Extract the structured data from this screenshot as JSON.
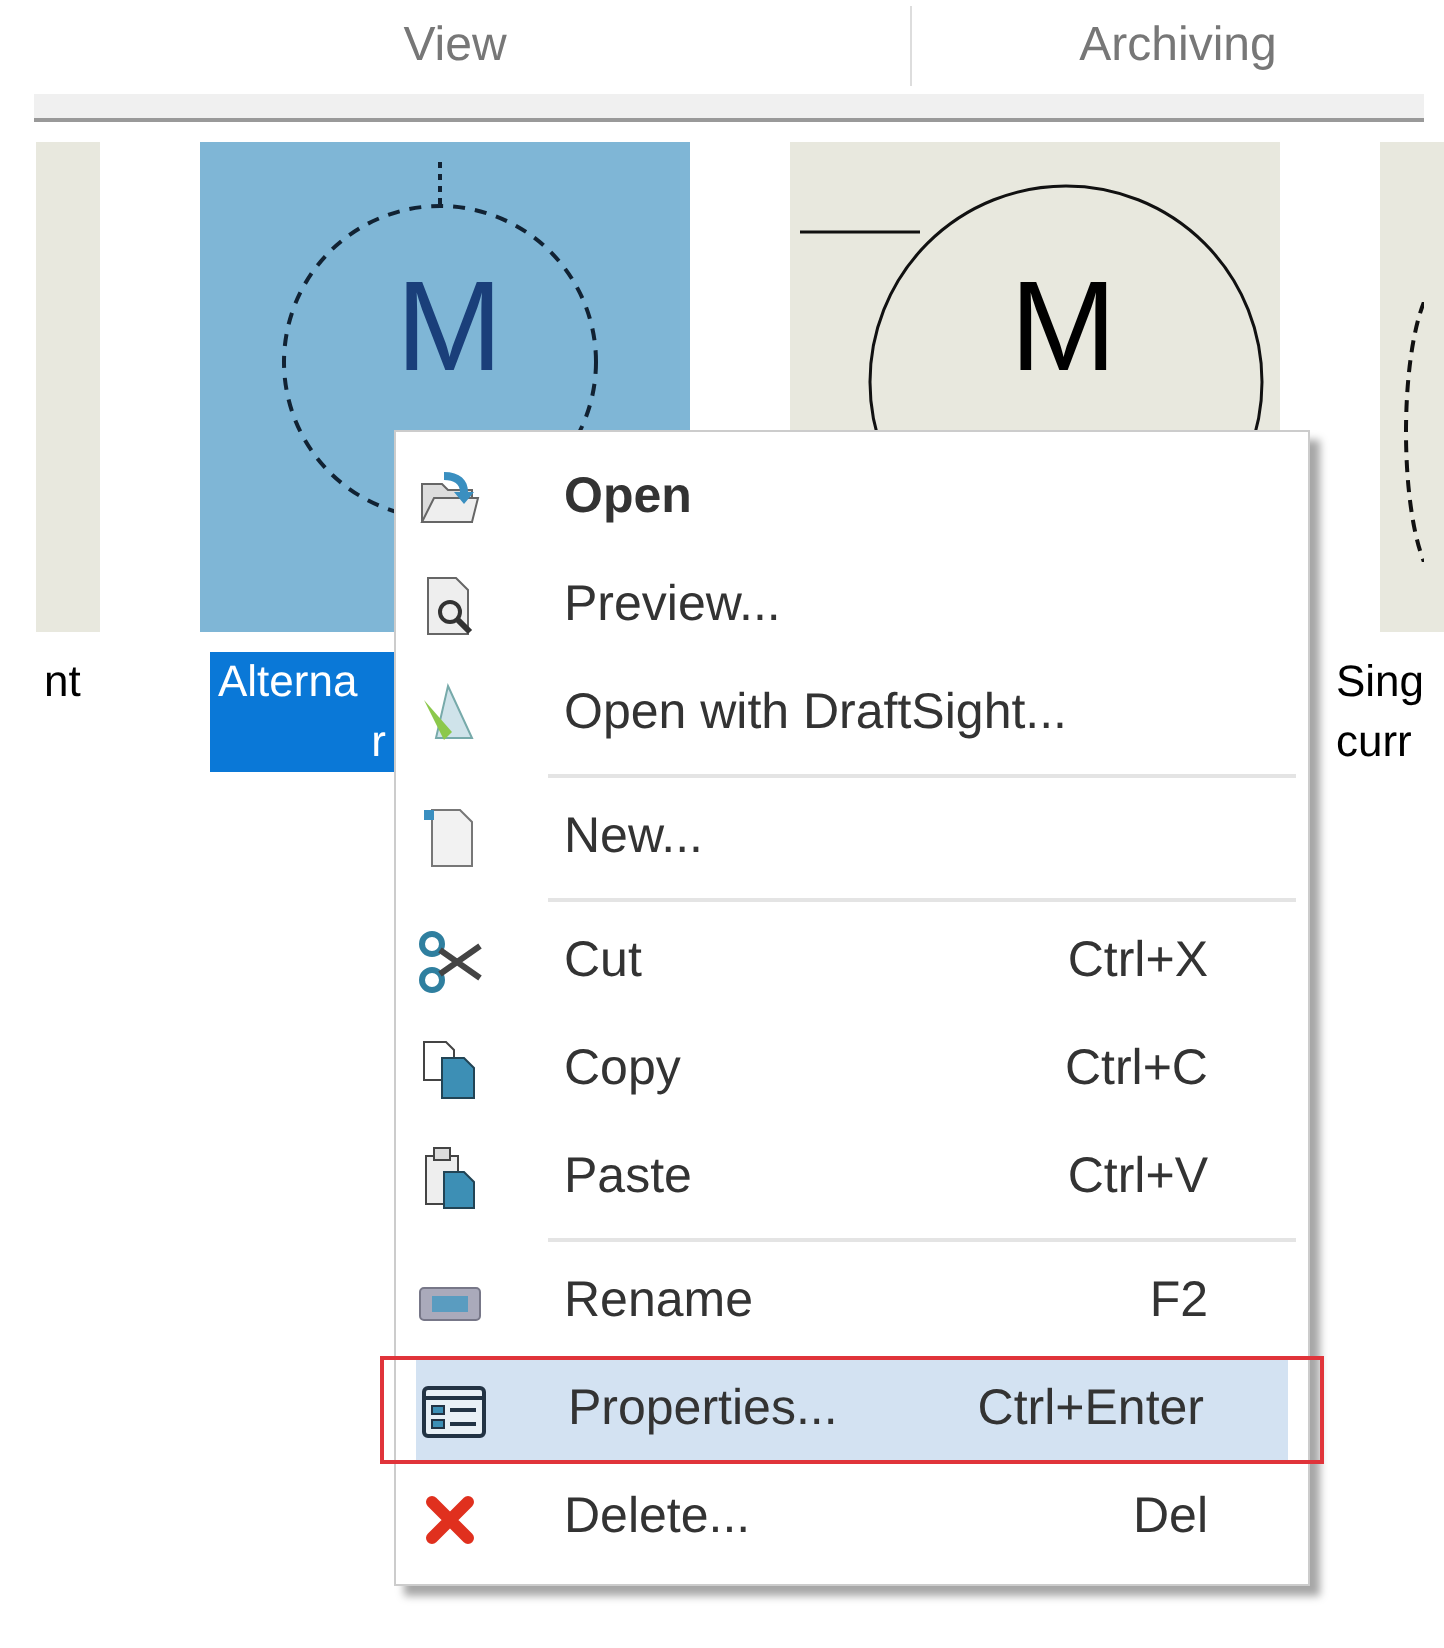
{
  "ribbon_tabs": [
    {
      "label": "View"
    },
    {
      "label": "Archiving"
    }
  ],
  "tiles": [
    {
      "kind": "partial",
      "label_lines": [
        "nt"
      ],
      "selected": false
    },
    {
      "kind": "dashed",
      "symbol": "M",
      "label_lines": [
        "Alterna",
        "r"
      ],
      "selected": true
    },
    {
      "kind": "solid",
      "symbol": "M",
      "selected": false
    },
    {
      "kind": "edge",
      "label_lines": [
        "Sing",
        "curr"
      ],
      "selected": false
    }
  ],
  "context_menu": [
    {
      "kind": "item",
      "label": "Open",
      "default": true,
      "selected": false
    },
    {
      "kind": "item",
      "label": "Preview...",
      "default": false,
      "selected": false
    },
    {
      "kind": "item",
      "label": "Open with DraftSight...",
      "default": false,
      "selected": false
    },
    {
      "kind": "separator"
    },
    {
      "kind": "item",
      "label": "New...",
      "default": false,
      "selected": false
    },
    {
      "kind": "separator"
    },
    {
      "kind": "item",
      "label": "Cut",
      "shortcut": "Ctrl+X",
      "default": false,
      "selected": false
    },
    {
      "kind": "item",
      "label": "Copy",
      "shortcut": "Ctrl+C",
      "default": false,
      "selected": false
    },
    {
      "kind": "item",
      "label": "Paste",
      "shortcut": "Ctrl+V",
      "default": false,
      "selected": false
    },
    {
      "kind": "separator"
    },
    {
      "kind": "item",
      "label": "Rename",
      "shortcut": "F2",
      "default": false,
      "selected": false
    },
    {
      "kind": "item",
      "label": "Properties...",
      "shortcut": "Ctrl+Enter",
      "default": false,
      "selected": true
    },
    {
      "kind": "item",
      "label": "Delete...",
      "shortcut": "Del",
      "default": false,
      "selected": false
    }
  ]
}
